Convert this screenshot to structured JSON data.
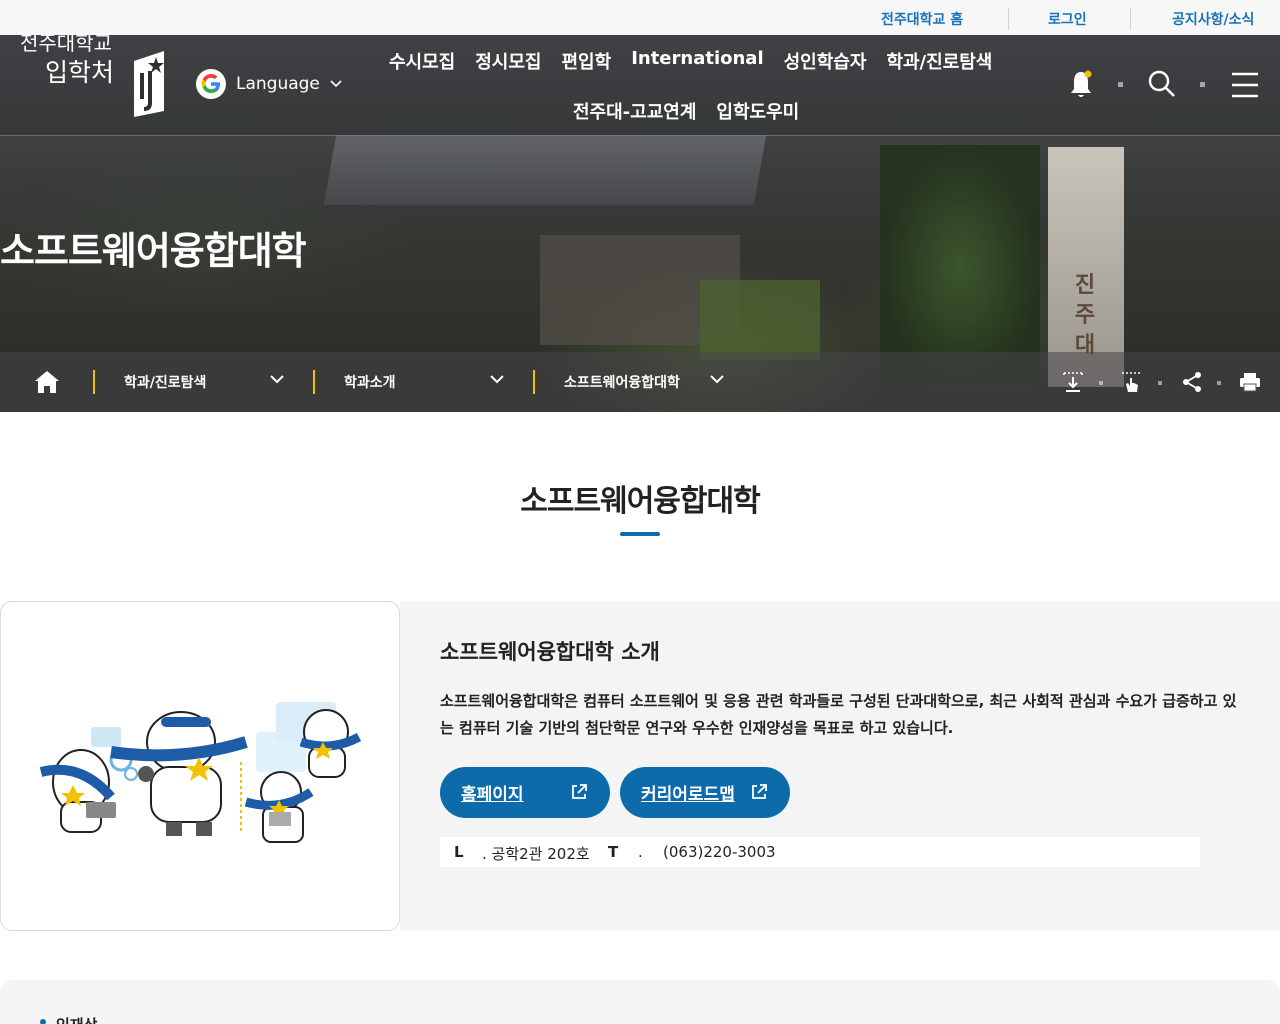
{
  "utility": {
    "home_link": "전주대학교 홈",
    "login": "로그인",
    "notice": "공지사항/소식"
  },
  "logo": {
    "line1": "전주대학교",
    "line2": "입학처"
  },
  "language": {
    "label": "Language"
  },
  "menu": {
    "row1": [
      "수시모집",
      "정시모집",
      "편입학",
      "International",
      "성인학습자",
      "학과/진로탐색"
    ],
    "row2": [
      "전주대-고교연계",
      "입학도우미"
    ]
  },
  "hero": {
    "title": "소프트웨어융합대학",
    "tower_text": [
      "진",
      "주",
      "대"
    ]
  },
  "breadcrumb": {
    "items": [
      "학과/진로탐색",
      "학과소개",
      "소프트웨어융합대학"
    ]
  },
  "page": {
    "title": "소프트웨어융합대학"
  },
  "intro": {
    "heading": "소프트웨어융합대학 소개",
    "description": "소프트웨어융합대학은 컴퓨터 소프트웨어 및 응용 관련 학과들로 구성된 단과대학으로, 최근 사회적 관심과 수요가 급증하고 있는 컴퓨터 기술 기반의 첨단학문 연구와 우수한 인재양성을 목표로 하고 있습니다.",
    "homepage_button": "홈페이지",
    "career_button": "커리어로드맵",
    "location_key": "L",
    "location_value": ". 공학2관 202호",
    "phone_key": "T",
    "phone_value": ".",
    "phone_number": "(063)220-3003"
  },
  "lower": {
    "label": "인재상"
  },
  "colors": {
    "accent": "#0e6bab",
    "utility_link": "#1a73b8",
    "breadcrumb_bar": "#f2c200"
  }
}
